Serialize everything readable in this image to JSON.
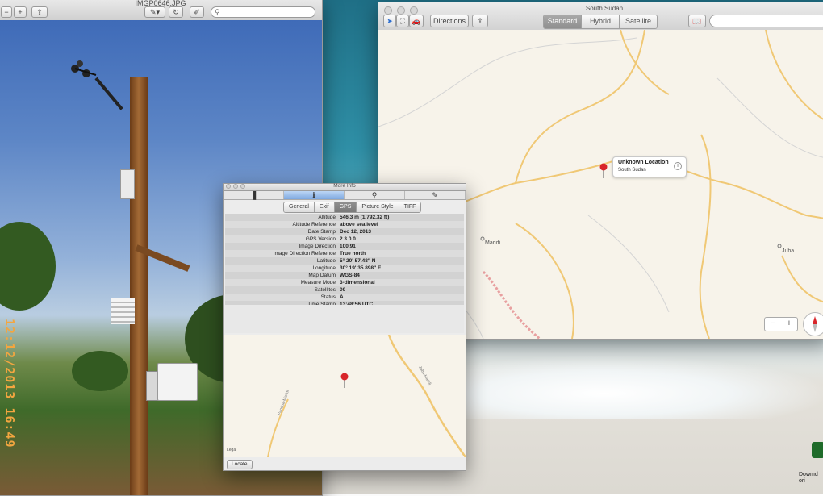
{
  "preview": {
    "title": "IMGP0646.JPG",
    "timestamp_overlay": "12:12/2013 16:49"
  },
  "maps": {
    "title": "South Sudan",
    "directions_label": "Directions",
    "view_modes": [
      "Standard",
      "Hybrid",
      "Satellite"
    ],
    "selected_view": "Standard",
    "callout": {
      "title": "Unknown Location",
      "subtitle": "South Sudan"
    },
    "places": [
      "Maridi",
      "Juba"
    ],
    "zoom": {
      "minus": "−",
      "plus": "+"
    }
  },
  "info": {
    "title": "More Info",
    "subtabs": [
      "General",
      "Exif",
      "GPS",
      "Picture Style",
      "TIFF"
    ],
    "selected_subtab": "GPS",
    "rows": [
      {
        "k": "Altitude",
        "v": "546.3 m (1,792.32 ft)"
      },
      {
        "k": "Altitude Reference",
        "v": "above sea level"
      },
      {
        "k": "Date Stamp",
        "v": "Dec 12, 2013"
      },
      {
        "k": "GPS Version",
        "v": "2.3.0.0"
      },
      {
        "k": "Image Direction",
        "v": "100.91"
      },
      {
        "k": "Image Direction Reference",
        "v": "True north"
      },
      {
        "k": "Latitude",
        "v": "5° 20' 57.48\" N"
      },
      {
        "k": "Longitude",
        "v": "30° 19' 35.898\" E"
      },
      {
        "k": "Map Datum",
        "v": "WGS-84"
      },
      {
        "k": "Measure Mode",
        "v": "3-dimensional"
      },
      {
        "k": "Satellites",
        "v": "09"
      },
      {
        "k": "Status",
        "v": "A"
      },
      {
        "k": "Time Stamp",
        "v": "13:48:56 UTC"
      }
    ],
    "map_roads": [
      "Juba-Maridi",
      "Pandua-Maridi"
    ],
    "legal": "Legal",
    "locate_label": "Locate"
  },
  "desktop": {
    "icon_label_1": "Dowmd",
    "icon_label_2": "ori"
  }
}
